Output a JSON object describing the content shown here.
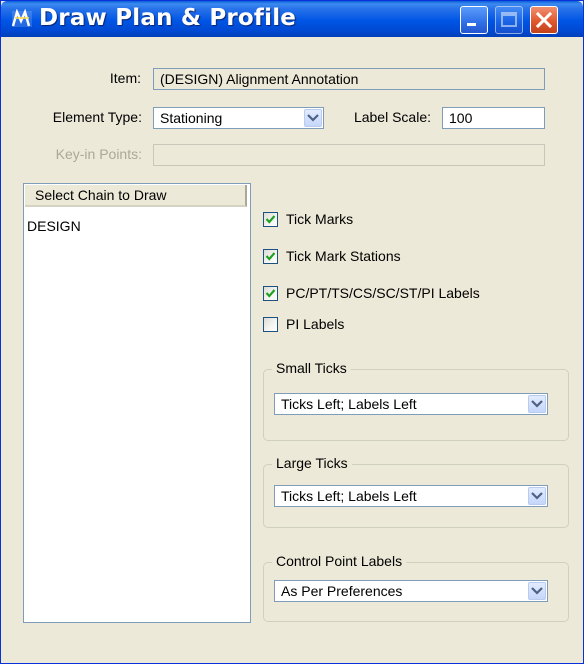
{
  "window": {
    "title": "Draw Plan & Profile",
    "icon": "app-icon"
  },
  "form": {
    "item_label": "Item:",
    "item_value": "(DESIGN) Alignment Annotation",
    "element_type_label": "Element Type:",
    "element_type_value": "Stationing",
    "label_scale_label": "Label Scale:",
    "label_scale_value": "100",
    "keyin_points_label": "Key-in Points:",
    "keyin_points_value": ""
  },
  "chain_list": {
    "header": "Select Chain to Draw",
    "items": [
      "DESIGN"
    ]
  },
  "options": [
    {
      "label": "Tick Marks",
      "checked": true
    },
    {
      "label": "Tick Mark Stations",
      "checked": true
    },
    {
      "label": "PC/PT/TS/CS/SC/ST/PI Labels",
      "checked": true
    },
    {
      "label": "PI Labels",
      "checked": false
    }
  ],
  "groups": {
    "small_ticks": {
      "title": "Small Ticks",
      "value": "Ticks Left; Labels Left"
    },
    "large_ticks": {
      "title": "Large Ticks",
      "value": "Ticks Left; Labels Left"
    },
    "control_point_labels": {
      "title": "Control Point Labels",
      "value": "As Per Preferences"
    }
  },
  "colors": {
    "titlebar": "#0055e5",
    "close_button": "#e0582e",
    "check_mark": "#21a121",
    "window_bg": "#ece9d8"
  }
}
